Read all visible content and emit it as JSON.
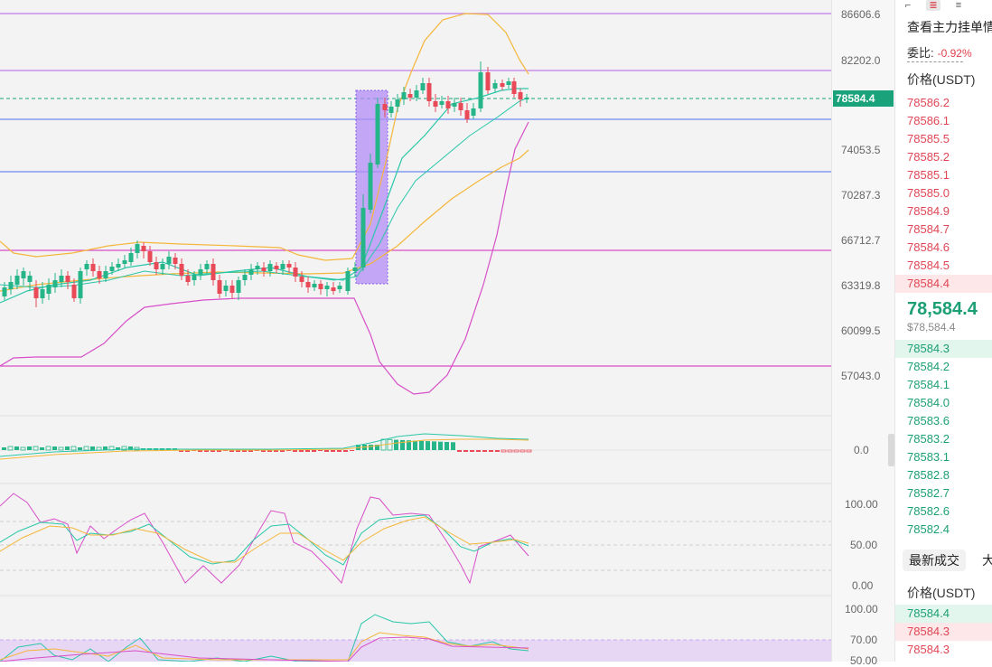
{
  "price_axis": {
    "labels": [
      "86606.6",
      "82202.0",
      "74053.5",
      "70287.3",
      "66712.7",
      "63319.8",
      "60099.5",
      "57043.0"
    ],
    "macd_label": "0.0",
    "kdj_labels": [
      "100.00",
      "50.00",
      "0.00"
    ],
    "rsi_labels": [
      "100.00",
      "70.00",
      "50.00"
    ],
    "current_price_tag": "78584.4"
  },
  "right_panel": {
    "title": "查看主力挂单情",
    "ratio_label": "委比:",
    "ratio_value": "-0.92%",
    "price_header": "价格(USDT)",
    "asks": [
      "78586.2",
      "78586.1",
      "78585.5",
      "78585.2",
      "78585.1",
      "78585.0",
      "78584.9",
      "78584.7",
      "78584.6",
      "78584.5",
      "78584.4"
    ],
    "last_price": "78,584.4",
    "last_price_usd": "$78,584.4",
    "bids": [
      "78584.3",
      "78584.2",
      "78584.1",
      "78584.0",
      "78583.6",
      "78583.2",
      "78583.1",
      "78582.8",
      "78582.7",
      "78582.6",
      "78582.4"
    ],
    "tabs": [
      "最新成交",
      "大"
    ],
    "trades_header": "价格(USDT)",
    "trades": [
      {
        "price": "78584.4",
        "side": "buy"
      },
      {
        "price": "78584.3",
        "side": "sell"
      },
      {
        "price": "78584.3",
        "side": "sell"
      }
    ]
  },
  "colors": {
    "up": "#26b589",
    "down": "#e84a57",
    "horizontal_purple": "#c27ce8",
    "horizontal_blue": "#6b8cf0",
    "highlight_box": "#b38cf5",
    "bollinger": "#d84fc8",
    "ma_orange": "#f5b63a",
    "ma_teal": "#2bc7a8",
    "current_price_bg": "#1aa37a"
  }
}
